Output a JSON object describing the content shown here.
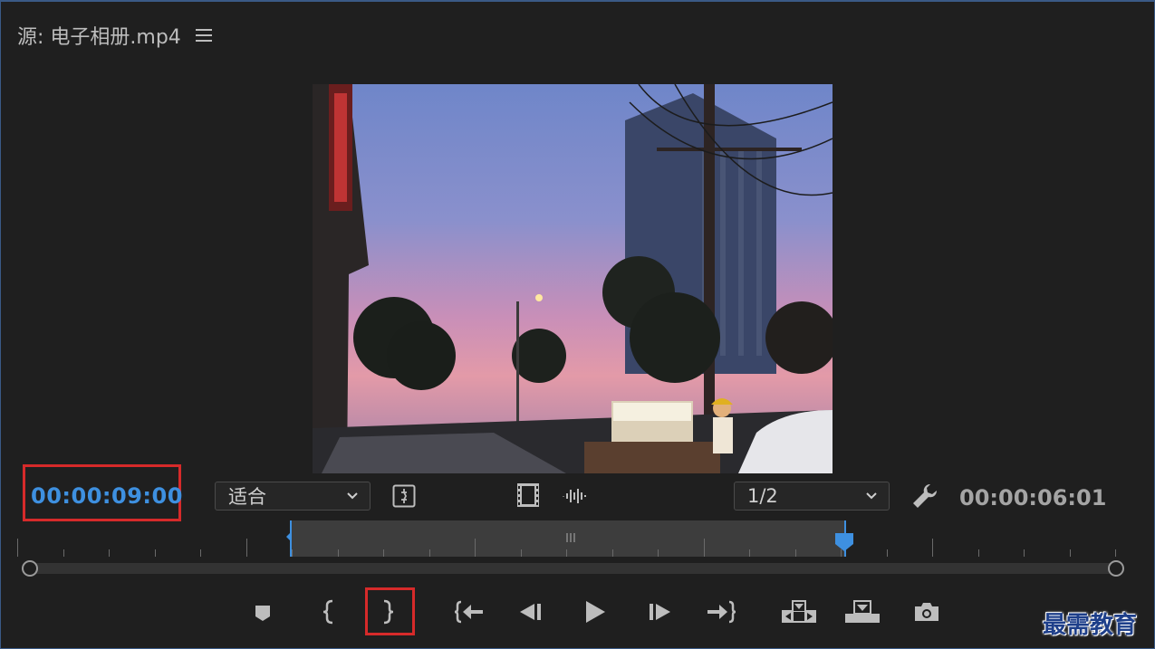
{
  "title": {
    "prefix": "源:",
    "clip_name": "电子相册.mp4"
  },
  "playhead_timecode": "00:00:09:00",
  "fit_select": {
    "value": "适合"
  },
  "resolution_select": {
    "value": "1/2"
  },
  "duration_timecode": "00:00:06:01",
  "watermark": "最需教育",
  "icons": {
    "menu": "hamburger-menu-icon",
    "insert_export_frame": "safe-margins-icon",
    "drag_video": "film-strip-icon",
    "drag_audio": "audio-waveform-icon",
    "settings": "wrench-icon",
    "controls": [
      "add-marker-icon",
      "mark-in-icon",
      "mark-out-icon",
      "go-to-in-icon",
      "step-back-icon",
      "play-icon",
      "step-forward-icon",
      "go-to-out-icon",
      "insert-icon",
      "overwrite-icon",
      "export-frame-icon"
    ]
  },
  "colors": {
    "timecode_blue": "#3e90e0",
    "highlight_red": "#d62a2a",
    "panel_border": "#3a5a86"
  }
}
